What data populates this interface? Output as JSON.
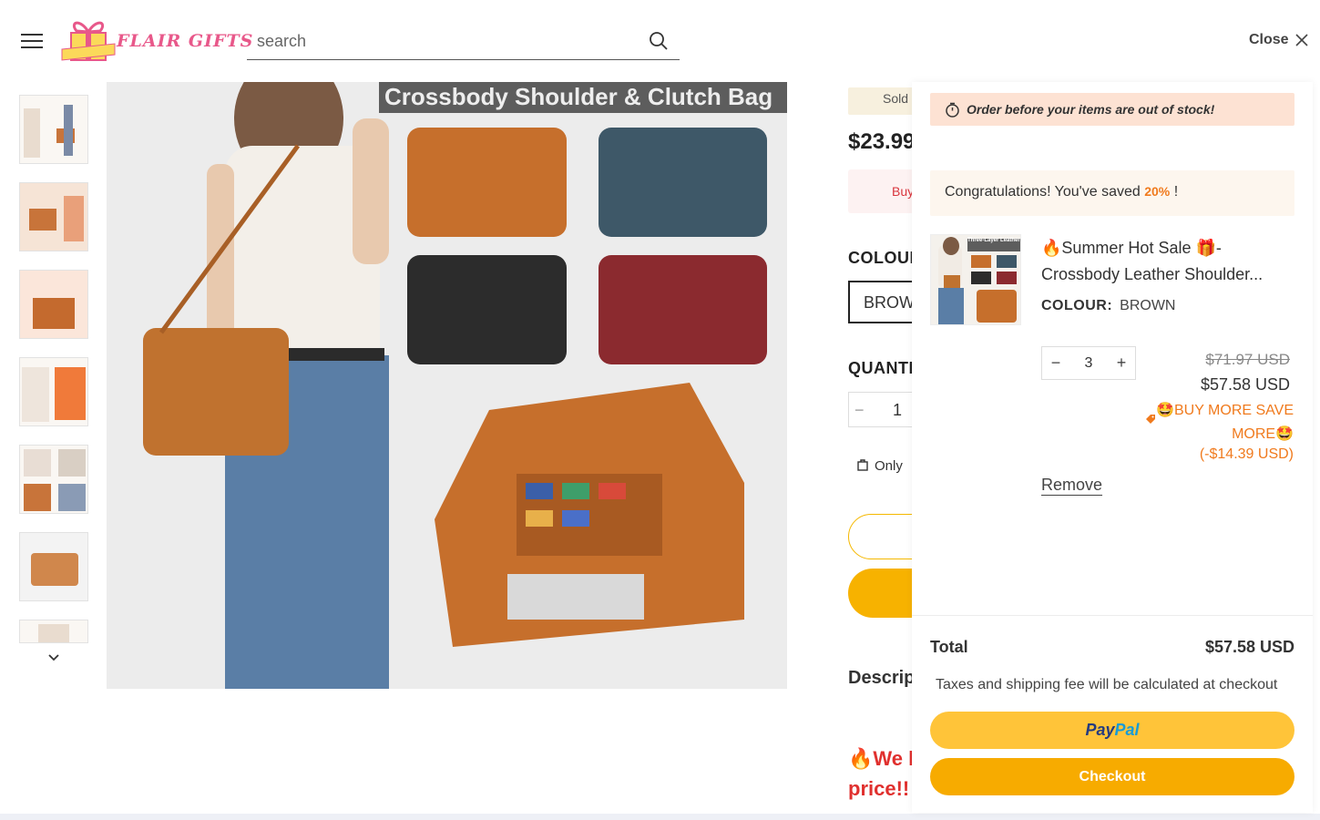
{
  "header": {
    "menu_icon": "hamburger-icon",
    "logo_text": "FLAIR GIFTS",
    "logo_badge_text": "FLAIR GIFTS",
    "search_placeholder": "search",
    "search_icon": "search-icon",
    "close_label": "Close",
    "close_icon": "close-icon"
  },
  "product_page": {
    "main_image_banner": "Crossbody Shoulder & Clutch Bag",
    "sold_text": "Sold",
    "price": "$23.99",
    "buy_badge": "Buy",
    "colour_label": "COLOUR",
    "colour_value": "BROW",
    "quantity_label": "QUANTI",
    "quantity_value": "1",
    "quantity_minus": "−",
    "only_left": "Only",
    "description_label": "Descrip",
    "promo_text_1": "We h",
    "promo_text_2": "price!!"
  },
  "drawer": {
    "stock_banner": "Order before your items are out of stock!",
    "saved_prefix": "Congratulations! You've saved ",
    "saved_pct": "20%",
    "saved_suffix": " !",
    "item": {
      "title_line1": "Summer Hot Sale",
      "title_line1_suffix": "-",
      "title_line2": "Crossbody Leather Shoulder...",
      "thumb_caption": "Three-Layer Leather",
      "colour_label": "COLOUR:",
      "colour_value": "BROWN",
      "qty": "3",
      "minus": "−",
      "plus": "+",
      "old_price": "$71.97 USD",
      "new_price": "$57.58 USD",
      "save_more": "BUY MORE SAVE MORE",
      "save_amount": "(-$14.39 USD)",
      "remove": "Remove"
    },
    "total_label": "Total",
    "total_value": "$57.58 USD",
    "tax_note": "Taxes and shipping fee will be calculated at checkout",
    "paypal_1": "Pay",
    "paypal_2": "Pal",
    "checkout": "Checkout"
  },
  "colors": {
    "accent_orange": "#f07a1d",
    "checkout_yellow": "#f7ab00",
    "paypal_yellow": "#ffc439",
    "logo_pink": "#e8588a",
    "promo_red": "#e0302e"
  }
}
